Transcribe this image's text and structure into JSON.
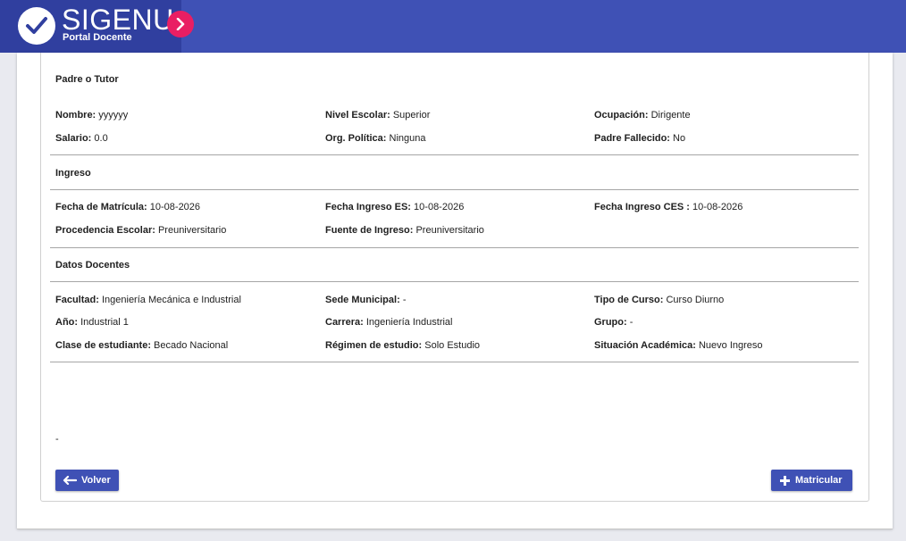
{
  "header": {
    "brand": "SIGENU",
    "subtitle": "Portal Docente",
    "accent": "#3f51b5",
    "toggle_color": "#e91e63",
    "icons": [
      "check-circle-icon",
      "chevron-right-icon"
    ]
  },
  "padre": {
    "title": "Padre o Tutor",
    "fields": [
      {
        "label": "Nombre:",
        "value": "yyyyyy"
      },
      {
        "label": "Nivel Escolar:",
        "value": "Superior"
      },
      {
        "label": "Ocupación:",
        "value": "Dirigente"
      },
      {
        "label": "Salario:",
        "value": "0.0"
      },
      {
        "label": "Org. Política:",
        "value": "Ninguna"
      },
      {
        "label": "Padre Fallecido:",
        "value": "No"
      }
    ]
  },
  "ingreso": {
    "title": "Ingreso",
    "fields": [
      {
        "label": "Fecha de Matrícula:",
        "value": "10-08-2026"
      },
      {
        "label": "Fecha Ingreso ES:",
        "value": "10-08-2026"
      },
      {
        "label": "Fecha Ingreso CES :",
        "value": "10-08-2026"
      },
      {
        "label": "Procedencia Escolar:",
        "value": "Preuniversitario"
      },
      {
        "label": "Fuente de Ingreso:",
        "value": "Preuniversitario"
      }
    ]
  },
  "docentes": {
    "title": "Datos Docentes",
    "fields": [
      {
        "label": "Facultad:",
        "value": "Ingeniería Mecánica e Industrial"
      },
      {
        "label": "Sede Municipal:",
        "value": "-"
      },
      {
        "label": "Tipo de Curso:",
        "value": "Curso Diurno"
      },
      {
        "label": "Año:",
        "value": "Industrial 1"
      },
      {
        "label": "Carrera:",
        "value": "Ingeniería Industrial"
      },
      {
        "label": "Grupo:",
        "value": "-"
      },
      {
        "label": "Clase de estudiante:",
        "value": "Becado Nacional"
      },
      {
        "label": "Régimen de estudio:",
        "value": "Solo Estudio"
      },
      {
        "label": "Situación Académica:",
        "value": "Nuevo Ingreso"
      }
    ]
  },
  "footer": {
    "dash": "-",
    "back_label": "Volver",
    "enroll_label": "Matricular",
    "icons": [
      "arrow-left-icon",
      "plus-icon"
    ]
  }
}
